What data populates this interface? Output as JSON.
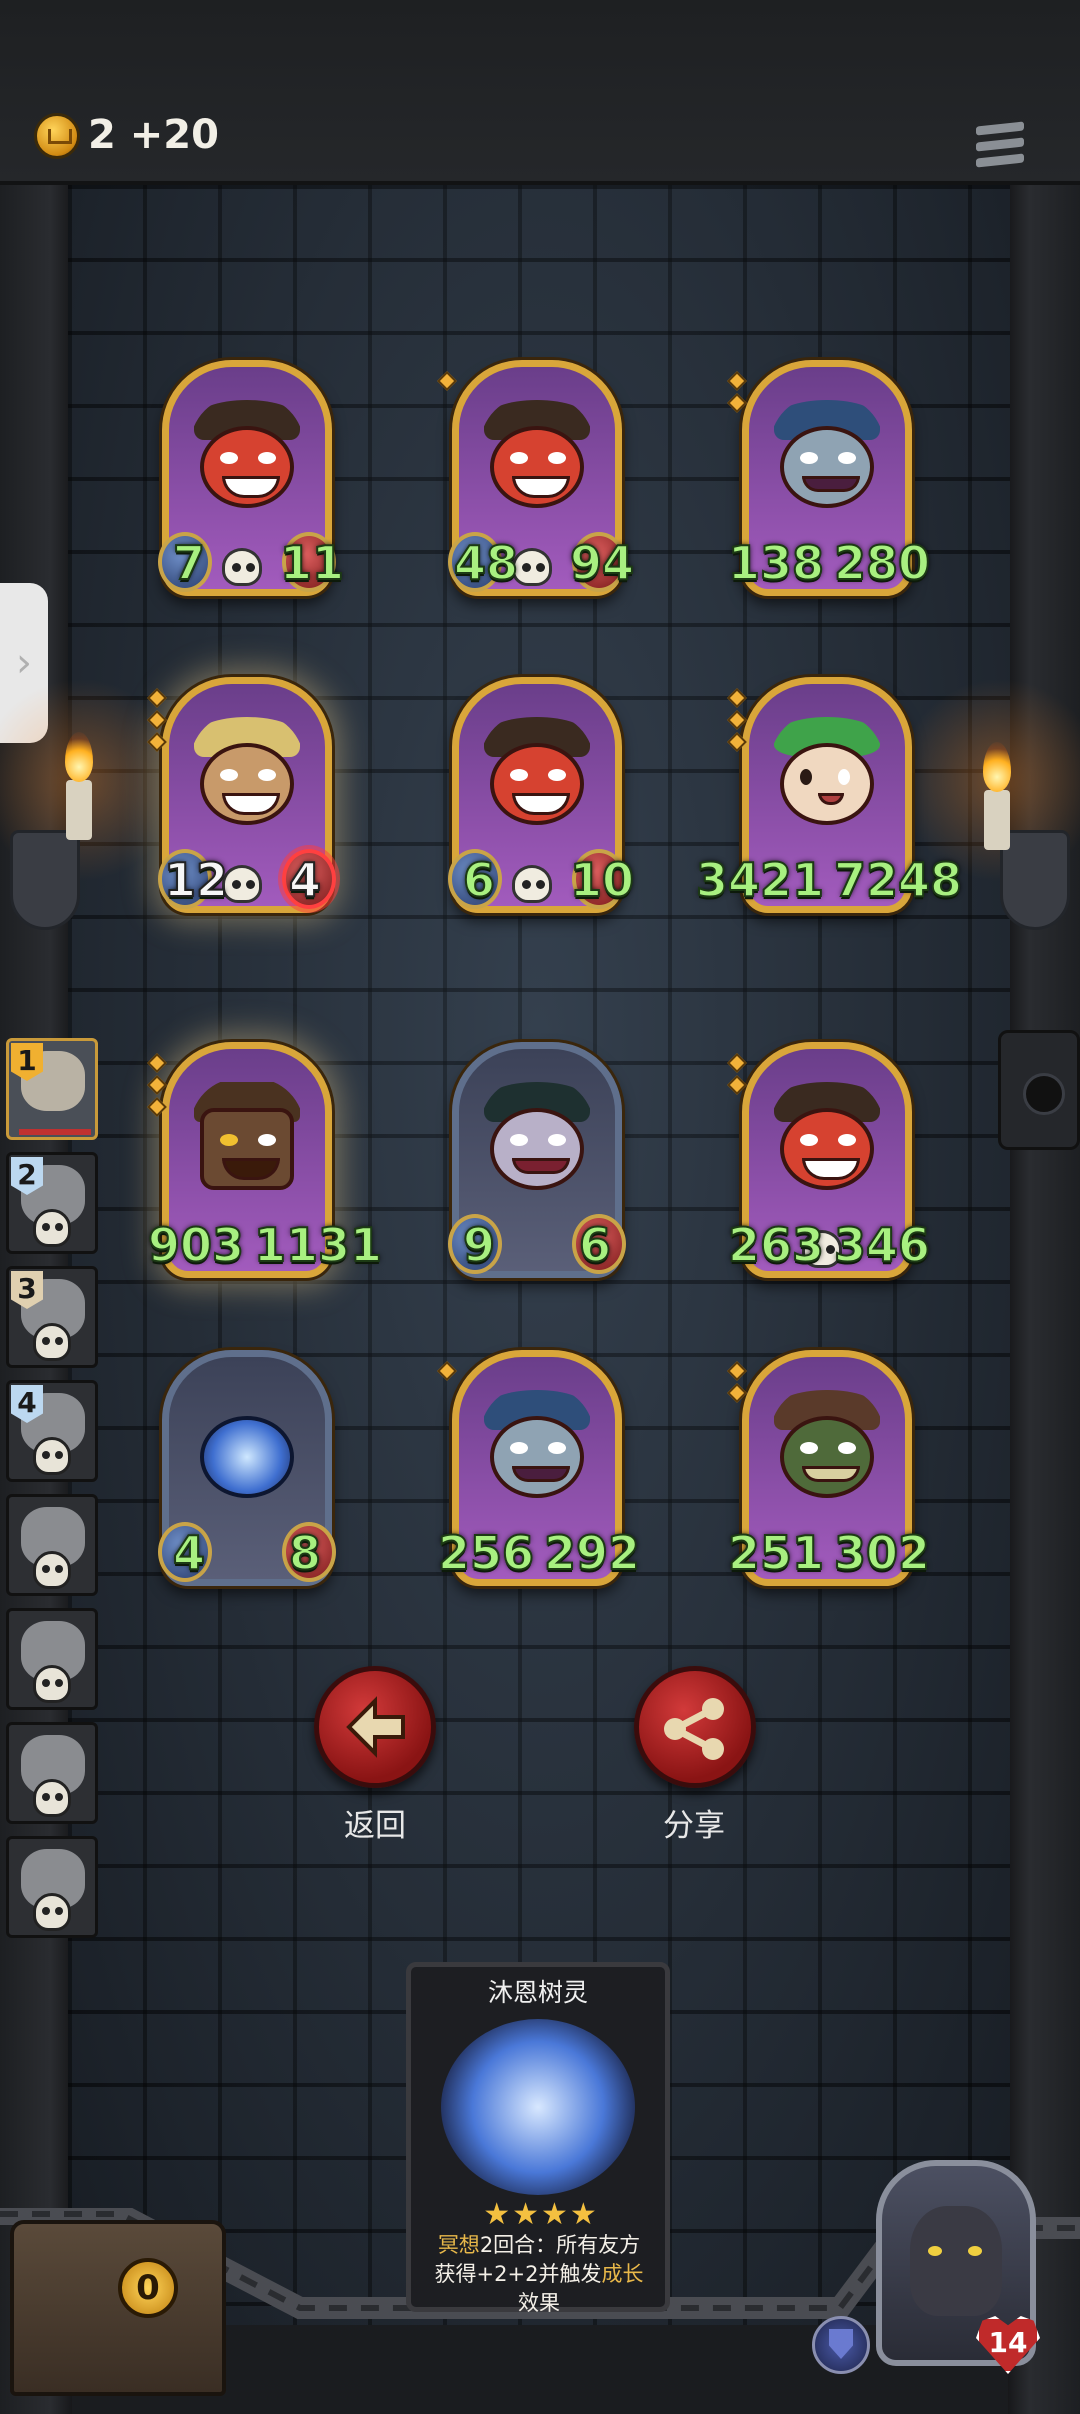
{
  "header": {
    "gold_amount": "2",
    "gold_income": "+20"
  },
  "board": {
    "cards": [
      {
        "art": "demon-red",
        "attack": "7",
        "health": "11",
        "stars": 0
      },
      {
        "art": "demon-red",
        "attack": "48",
        "health": "94",
        "stars": 1
      },
      {
        "art": "elf",
        "attack": "138",
        "health": "280",
        "stars": 2
      },
      {
        "art": "hat",
        "attack": "12",
        "health": "4",
        "stars": 3,
        "highlighted": true
      },
      {
        "art": "demon-red",
        "attack": "6",
        "health": "10",
        "stars": 0
      },
      {
        "art": "leaf",
        "attack": "3421",
        "health": "7248",
        "stars": 3
      },
      {
        "art": "tree",
        "attack": "903",
        "health": "1131",
        "stars": 3,
        "highlighted": true
      },
      {
        "art": "demon-horn",
        "attack": "9",
        "health": "6",
        "stars": 0
      },
      {
        "art": "demon-red",
        "attack": "263",
        "health": "346",
        "stars": 2
      },
      {
        "art": "crystal",
        "attack": "4",
        "health": "8",
        "stars": 0
      },
      {
        "art": "elf",
        "attack": "256",
        "health": "292",
        "stars": 1
      },
      {
        "art": "goblin",
        "attack": "251",
        "health": "302",
        "stars": 2
      }
    ]
  },
  "opponents": [
    {
      "rank": "1",
      "active": true
    },
    {
      "rank": "2"
    },
    {
      "rank": "3"
    },
    {
      "rank": "4"
    },
    {
      "rank": ""
    },
    {
      "rank": ""
    },
    {
      "rank": ""
    },
    {
      "rank": ""
    }
  ],
  "actions": {
    "back_label": "返回",
    "share_label": "分享"
  },
  "detail_card": {
    "name": "沐恩树灵",
    "stars": "★★★★",
    "desc_1a": "冥想",
    "desc_1b": "2回合：所有友方",
    "desc_2a": "获得+2+2并触发",
    "desc_2b": "成长",
    "desc_3": "效果"
  },
  "shop": {
    "refresh_count": "0"
  },
  "player": {
    "health": "14"
  },
  "colors": {
    "stat_green": "#a8f080",
    "gold_frame": "#d9a63a",
    "button_red": "#c02a2a"
  }
}
